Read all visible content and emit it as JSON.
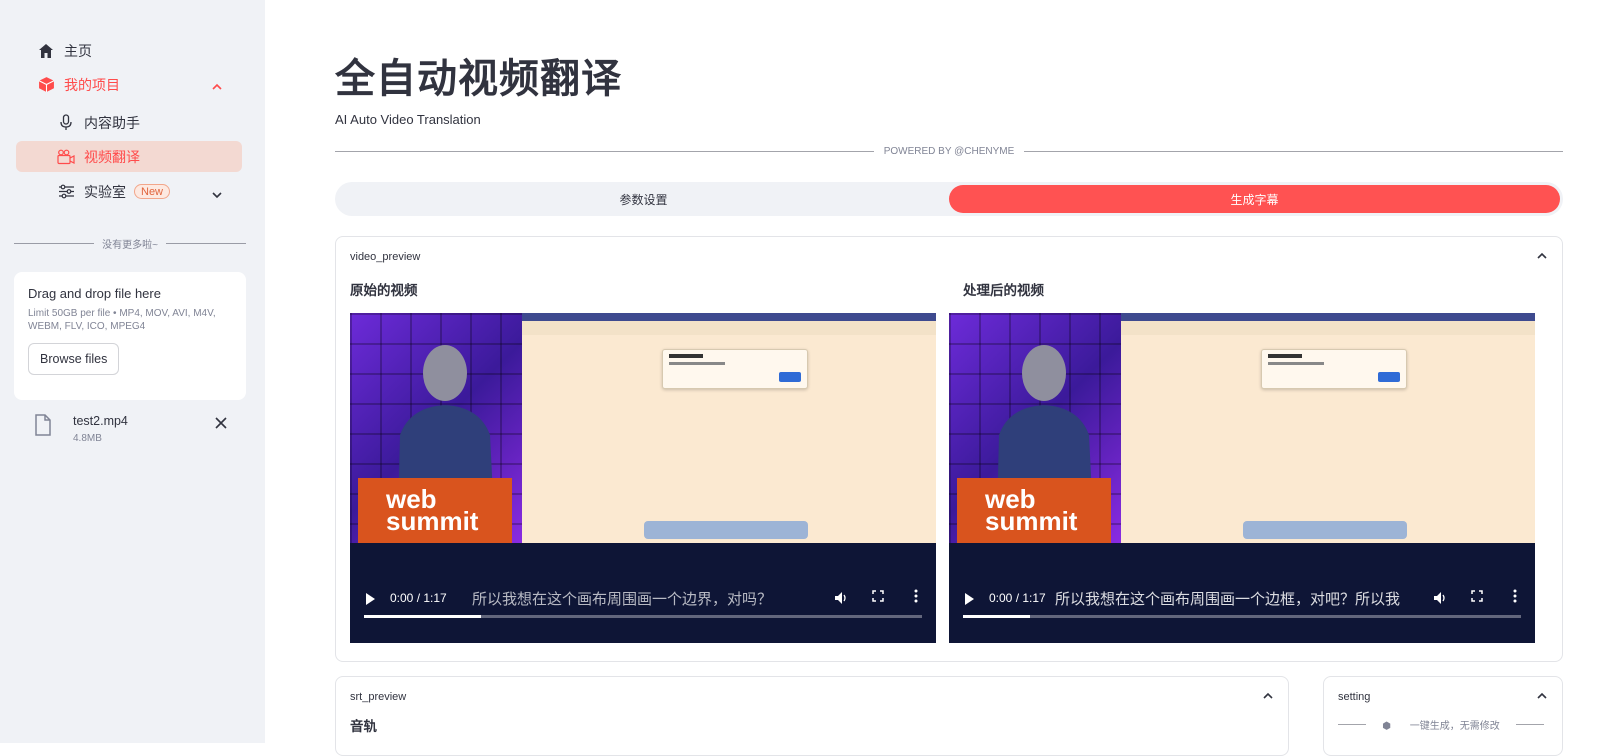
{
  "sidebar": {
    "items": [
      {
        "label": "主页",
        "icon": "home-icon"
      },
      {
        "label": "我的项目",
        "icon": "box-icon"
      },
      {
        "label": "内容助手",
        "icon": "microphone-icon"
      },
      {
        "label": "视频翻译",
        "icon": "video-camera-icon"
      },
      {
        "label": "实验室",
        "icon": "sliders-icon",
        "badge": "New"
      }
    ],
    "divider_text": "没有更多啦~",
    "uploader": {
      "drop_text": "Drag and drop file here",
      "limit_text": "Limit 50GB per file • MP4, MOV, AVI, M4V, WEBM, FLV, ICO, MPEG4",
      "browse_label": "Browse files"
    },
    "file": {
      "name": "test2.mp4",
      "size": "4.8MB"
    }
  },
  "main": {
    "title": "全自动视频翻译",
    "subtitle": "AI Auto Video Translation",
    "powered_by": "POWERED BY @CHENYME",
    "tabs": [
      {
        "label": "参数设置",
        "active": false
      },
      {
        "label": "生成字幕",
        "active": true
      }
    ],
    "video_panel": {
      "label": "video_preview",
      "original_title": "原始的视频",
      "processed_title": "处理后的视频",
      "original_video": {
        "time": "0:00 / 1:17",
        "subtitle": "所以我想在这个画布周围画一个边界，对吗？",
        "progress": 0.21
      },
      "processed_video": {
        "time": "0:00 / 1:17",
        "subtitle": "所以我想在这个画布周围画一个边框，对吧？所以我",
        "progress": 0.12
      }
    },
    "srt_panel": {
      "label": "srt_preview",
      "heading": "音轨"
    },
    "setting_panel": {
      "label": "setting",
      "sub_text": "一键生成，无需修改"
    }
  },
  "colors": {
    "accent": "#ff4b4b",
    "sidebar_bg": "#f0f2f6",
    "active_tab": "#ff5252"
  }
}
